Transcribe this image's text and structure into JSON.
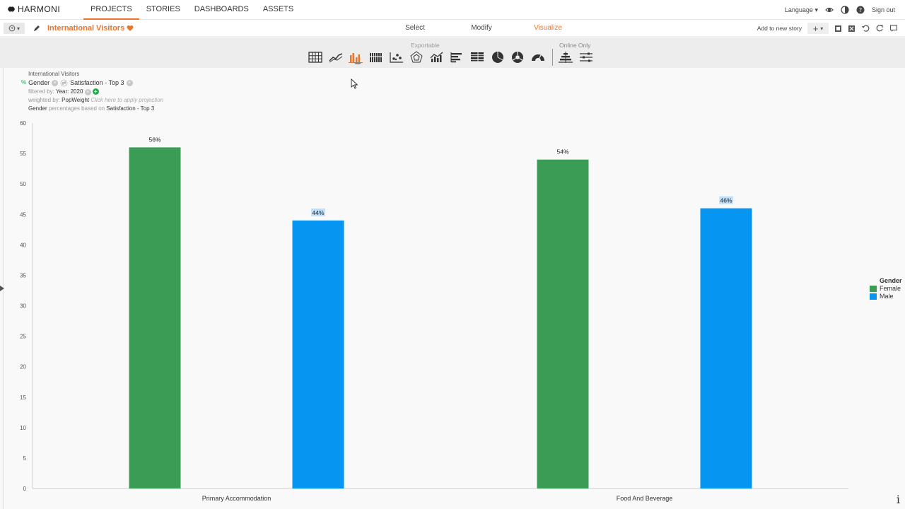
{
  "nav": {
    "brand": "HARMONI",
    "links": [
      "PROJECTS",
      "STORIES",
      "DASHBOARDS",
      "ASSETS"
    ],
    "active": "PROJECTS",
    "language": "Language",
    "signout": "Sign out"
  },
  "subbar": {
    "title": "International Visitors",
    "modes": [
      "Select",
      "Modify",
      "Visualize"
    ],
    "active_mode": "Visualize",
    "add_story": "Add to new story"
  },
  "toolbar": {
    "exportable_label": "Exportable",
    "online_only_label": "Online Only",
    "tools": [
      "table-icon",
      "line-chart-icon",
      "bar-chart-icon",
      "column-stack-icon",
      "scatter-icon",
      "radar-icon",
      "area-bars-icon",
      "horizontal-bar-icon",
      "stacked-horizontal-icon",
      "pie-icon",
      "donut-icon",
      "gauge-icon",
      "pyramid-icon",
      "slider-settings-icon"
    ],
    "active_tool": "bar-chart-icon"
  },
  "meta": {
    "name": "International Visitors",
    "pct": "%",
    "row_var": "Gender",
    "col_var": "Satisfaction - Top 3",
    "filter_label": "filtered by:",
    "filter_value": "Year: 2020",
    "weight_label": "weighted by:",
    "weight_value": "PopWeight",
    "projection_hint": "Click here to apply projection",
    "basis_var": "Gender",
    "basis_text": "percentages based on",
    "basis_value": "Satisfaction - Top 3"
  },
  "colors": {
    "female": "#3a9c55",
    "male": "#0795f2",
    "accent": "#e8762d"
  },
  "chart_data": {
    "type": "bar",
    "categories": [
      "Primary Accommodation",
      "Food And Beverage"
    ],
    "series": [
      {
        "name": "Female",
        "values": [
          56,
          54
        ],
        "labels": [
          "56%",
          "54%"
        ]
      },
      {
        "name": "Male",
        "values": [
          44,
          46
        ],
        "labels": [
          "44%",
          "46%"
        ]
      }
    ],
    "ylim": [
      0,
      60
    ],
    "yticks": [
      0,
      5,
      10,
      15,
      20,
      25,
      30,
      35,
      40,
      45,
      50,
      55,
      60
    ],
    "legend_title": "Gender",
    "legend_position": "right"
  }
}
